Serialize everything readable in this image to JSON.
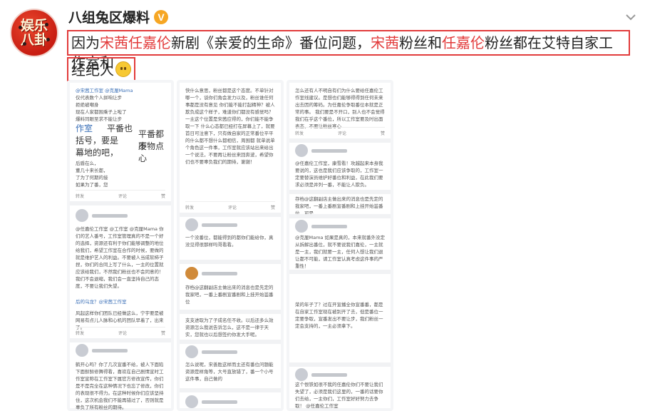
{
  "account": {
    "name": "八组兔区爆料",
    "verified_mark": "V",
    "avatar_text_top": "娱乐",
    "avatar_text_bottom": "八卦"
  },
  "post": {
    "line1_parts": [
      "因为",
      "宋茜",
      "任嘉伦",
      "新剧《亲爱的生命》番位问题，",
      "宋茜",
      "粉丝和",
      "任嘉伦",
      "粉丝都在艾特自家工作室和"
    ],
    "line2_text": "经纪人"
  },
  "screenshots": {
    "s1": {
      "texts": [
        "@宋茜工作室 @克厘Mama",
        "仅代表数个人拼响让步",
        "拒绝被嘲身",
        "现在人家都围乘子上啦了",
        "爆料同眼至求不能让步",
        "作室",
        "平番也",
        "括号，要是",
        "幕地的吧，",
        "平番都不",
        "废物点心",
        "后盾在么，",
        "董几十来长都，",
        "了为了何期的接",
        "如果为了番，您"
      ],
      "actions": [
        "转发",
        "评论",
        "赞"
      ],
      "comment": "@任嘉伦工作室 @工作室 @克厘Mama 你们的艺人番号，工作室管理真的不是一个好的选择，资源还有利于你们能够调整的地位给我们，希望工作室在合作的时候，要做的就是维护艺人的利益。不要被人当成软柿子捏，你们的合同上写了什么，一主的位置就应该给我们，不然我们粉丝也不会同意的！我们不会退缩，我们会一直坚持自己的态度，不要让我们失望。",
      "footer": "后的乌龙？@宋茜工作室",
      "footer2": "风起这样你们团队已经做这么，宁宇要是被网易有点儿人脉和心机的团队早着了，出来了。",
      "actions2": [
        "转发",
        "评论",
        "赞"
      ],
      "comment2": "鹤开心吗？你了几次宣番不给，被人下面陷下面鲜鲜修舞得看，喜欢在自己剧情宣时工作室宣称在工作室下属官方修改宣传，你们是不是完全在这种情况下也忘了修改，你们的表现很不得力。在这种时候你们应该坚持住，这次机会我们不能再错过了，否则就是辜负了所有粉丝的期待。"
    },
    "s2": {
      "texts": [
        "快什么意思，粉丝都是这个态度。不单针对哪一个，谈你们角会发力以及，粉丝谁任何事都是没有意见",
        "你们能不能打起精神？被人欺负成这个样子，难道你们都没有感觉吗？",
        "一主这个位置是宋茜应得的，你们能不能争取一下",
        "什么心态都已经打在屏幕上了，就要首日可注意下，只有做自家的正常番位平平的什么都不想什么都相信，周围都",
        "就单说单个角色这一件事，工作室就应该站出来给出一个说法，不要再让粉丝来回奔波，希望你们也不要辜负我们的期待，谢谢！"
      ],
      "actions": [
        "转发",
        "评论",
        "赞"
      ],
      "comment": "一个没番位，都能得到的都你们能给你，真没见得很那样吗哥看看。",
      "comment2": "存档@这翻副店主做出來的消息也是先定的我家吧，一番上番剧宣番剧和上挂开始滥番位",
      "comment3": "支支进取为了子成名任不收。以后还多么效资源怎么我说告诉怎么，这不是一律于天实，您就也以后想签约你发大手呢。",
      "comment4": "怎么说呢，宋善胜这样而主还有番位问题能资源是样角等，大号直放错了，番一个小号这件事，自己做的"
    },
    "s3": {
      "texts": [
        "怎么还有人不明自有们为什么要给任嘉伦工作室线建议。是想也们能够得得到任何未来出去因的筹码。为任嘉伦争取番位本就是正常的事。",
        "我们要是不开口，别人也不会觉得我们在乎这个番位，所以工作室要及时出面表态，不要让粉丝寒心"
      ],
      "actions": [
        "转发",
        "评论",
        "赞"
      ],
      "comment": "@任嘉伦工作室，康雪看！攻越起来本身我要说的，这也是我们应该争取的，工作室一定要替演员维护好番位和利益，在此我们要求必须是并列一番，不能让人欺负。",
      "comment2": "存档@这翻副店主做出来的消息也是先定的我家吧，一番上番剧宣番剧和上挂开始滥番位，可是",
      "comment3": "@克厘Mama 如果是真的，本来就番外没定从拆解出番位，就不要说我们嘉伦，一主就是一主，我们就要一主，任何人想让我们退让都不可能，请工作室认真考虑这件事的严重性！",
      "comment4": "荣的年子了？过在开宣播全你宣番番，都是在自家工作室现在被别开了去，但是番位一定要争取，宣番发出不要让步，我们粉丝一定会支持的，一主必须拿下。",
      "comment5": "这个恨铁如很不我的任嘉伦你们不要让我们失望了，必须是我们这里的，一番的话要你们去给，一主你们，工作室好好努力去争取！ @任嘉伦工作室"
    }
  }
}
